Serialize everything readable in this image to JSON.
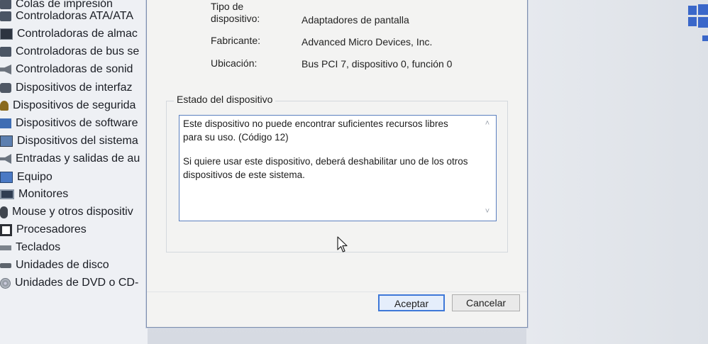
{
  "tree": {
    "items": [
      {
        "label": "Colas de impresión",
        "icon": "printer-icon"
      },
      {
        "label": "Controladoras ATA/ATA",
        "icon": "chip-icon"
      },
      {
        "label": "Controladoras de almac",
        "icon": "storage-controller-icon"
      },
      {
        "label": "Controladoras de bus se",
        "icon": "usb-controller-icon"
      },
      {
        "label": "Controladoras de sonid",
        "icon": "speaker-icon"
      },
      {
        "label": "Dispositivos de interfaz",
        "icon": "hid-icon"
      },
      {
        "label": "Dispositivos de segurida",
        "icon": "security-key-icon"
      },
      {
        "label": "Dispositivos de software",
        "icon": "software-device-icon"
      },
      {
        "label": "Dispositivos del sistema",
        "icon": "system-device-icon"
      },
      {
        "label": "Entradas y salidas de au",
        "icon": "audio-io-icon"
      },
      {
        "label": "Equipo",
        "icon": "computer-icon"
      },
      {
        "label": "Monitores",
        "icon": "monitor-icon"
      },
      {
        "label": "Mouse y otros dispositiv",
        "icon": "mouse-icon"
      },
      {
        "label": "Procesadores",
        "icon": "processor-icon"
      },
      {
        "label": "Teclados",
        "icon": "keyboard-icon"
      },
      {
        "label": "Unidades de disco",
        "icon": "disk-drive-icon"
      },
      {
        "label": "Unidades de DVD o CD-",
        "icon": "dvd-drive-icon"
      }
    ]
  },
  "dialog": {
    "device_type_label_line1": "Tipo de",
    "device_type_label_line2": "dispositivo:",
    "device_type_value": "Adaptadores de pantalla",
    "manufacturer_label": "Fabricante:",
    "manufacturer_value": "Advanced Micro Devices, Inc.",
    "location_label": "Ubicación:",
    "location_value": "Bus PCI 7, dispositivo 0, función 0",
    "status_group_label": "Estado del dispositivo",
    "status_line1": "Este dispositivo no puede encontrar suficientes recursos libres",
    "status_line2": "para su uso. (Código 12)",
    "status_line3": "Si quiere usar este dispositivo, deberá deshabilitar uno de los otros",
    "status_line4": "dispositivos de este sistema.",
    "ok_label": "Aceptar",
    "cancel_label": "Cancelar"
  },
  "colors": {
    "accent": "#3e78d8",
    "status_border": "#5b7fbf",
    "windows_blue": "#3a67c9"
  }
}
